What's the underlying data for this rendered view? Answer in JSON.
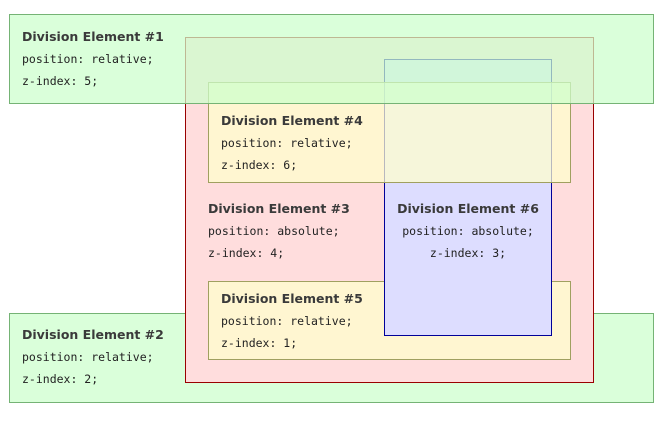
{
  "boxes": {
    "div1": {
      "title": "Division Element #1",
      "position": "position: relative;",
      "zindex": "z-index: 5;"
    },
    "div2": {
      "title": "Division Element #2",
      "position": "position: relative;",
      "zindex": "z-index: 2;"
    },
    "div3": {
      "title": "Division Element #3",
      "position": "position: absolute;",
      "zindex": "z-index: 4;"
    },
    "div4": {
      "title": "Division Element #4",
      "position": "position: relative;",
      "zindex": "z-index: 6;"
    },
    "div5": {
      "title": "Division Element #5",
      "position": "position: relative;",
      "zindex": "z-index: 1;"
    },
    "div6": {
      "title": "Division Element #6",
      "position": "position: absolute;",
      "zindex": "z-index: 3;"
    }
  },
  "colors": {
    "green_fill": "#ccffcc",
    "green_border": "#669966",
    "yellow_fill": "#ffffcc",
    "yellow_border": "#999966",
    "pink_fill": "#ffdddd",
    "pink_border": "#990000",
    "blue_fill": "#ddddff",
    "blue_border": "#000099"
  }
}
